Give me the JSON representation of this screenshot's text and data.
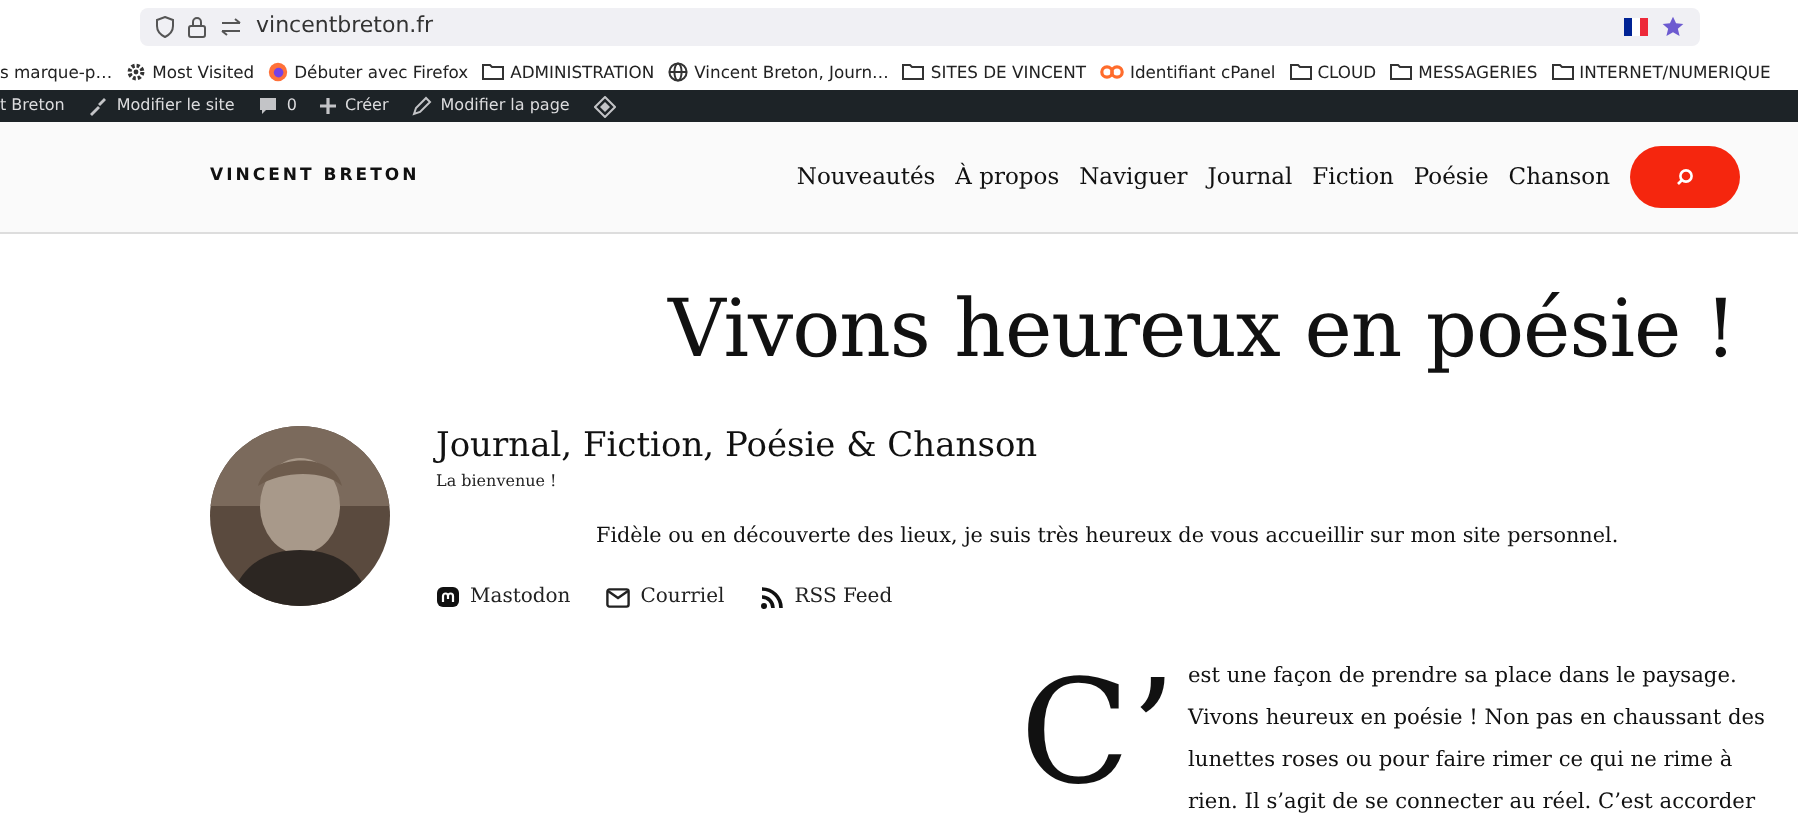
{
  "browser": {
    "url": "vincentbreton.fr",
    "bookmarks": [
      {
        "kind": "plain",
        "label": "s marque-p…"
      },
      {
        "kind": "gear",
        "label": "Most Visited"
      },
      {
        "kind": "firefox",
        "label": "Débuter avec Firefox"
      },
      {
        "kind": "folder",
        "label": "ADMINISTRATION"
      },
      {
        "kind": "globe",
        "label": "Vincent Breton, Journ…"
      },
      {
        "kind": "folder",
        "label": "SITES DE VINCENT"
      },
      {
        "kind": "cpanel",
        "label": "Identifiant cPanel"
      },
      {
        "kind": "folder",
        "label": "CLOUD"
      },
      {
        "kind": "folder",
        "label": "MESSAGERIES"
      },
      {
        "kind": "folder",
        "label": "INTERNET/NUMERIQUE"
      }
    ]
  },
  "admin_bar": [
    {
      "kind": "plain",
      "label": "t Breton"
    },
    {
      "kind": "brush",
      "label": "Modifier le site"
    },
    {
      "kind": "comment",
      "label": "0"
    },
    {
      "kind": "plus",
      "label": "Créer"
    },
    {
      "kind": "pencil",
      "label": "Modifier la page"
    },
    {
      "kind": "diamond"
    }
  ],
  "header": {
    "site_title": "VINCENT BRETON",
    "nav": [
      "Nouveautés",
      "À propos",
      "Naviguer",
      "Journal",
      "Fiction",
      "Poésie",
      "Chanson"
    ]
  },
  "page_title": "Vivons heureux en poésie !",
  "profile": {
    "heading": "Journal, Fiction, Poésie & Chanson",
    "tagline": "La bienvenue !",
    "intro": "Fidèle ou en découverte des lieux, je suis très heureux de vous accueillir sur mon site personnel.",
    "links": [
      {
        "kind": "mastodon",
        "label": "Mastodon"
      },
      {
        "kind": "mail",
        "label": "Courriel"
      },
      {
        "kind": "rss",
        "label": "RSS Feed"
      }
    ]
  },
  "article": {
    "drop_cap": "C’",
    "text": "est une façon de prendre sa place dans le paysage. Vivons heureux en poésie ! Non pas en chaussant des lunettes roses ou pour faire rimer ce qui ne rime à rien. Il s’agit de se connecter au réel. C’est accorder"
  }
}
